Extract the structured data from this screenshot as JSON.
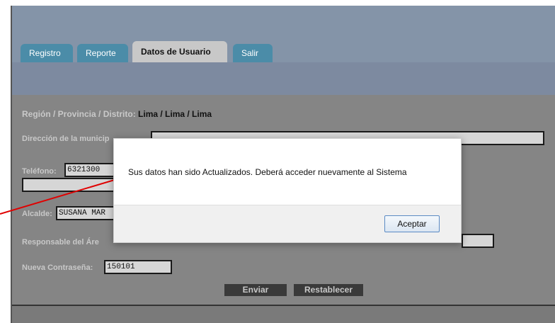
{
  "tabs": [
    {
      "label": "Registro",
      "active": false
    },
    {
      "label": "Reporte",
      "active": false
    },
    {
      "label": "Datos de Usuario",
      "active": true
    },
    {
      "label": "Salir",
      "active": false
    }
  ],
  "region": {
    "label": "Región / Provincia / Distrito:",
    "value": "Lima / Lima / Lima"
  },
  "form": {
    "direccion_label": "Dirección de la municip",
    "telefono_label": "Teléfono:",
    "telefono_value": "6321300",
    "alcalde_label": "Alcalde:",
    "alcalde_value": "SUSANA MAR",
    "responsable_label": "Responsable del Áre",
    "password_label": "Nueva Contraseña:",
    "password_value": "150101",
    "submit_label": "Enviar",
    "reset_label": "Restablecer"
  },
  "dialog": {
    "message": "Sus datos han sido Actualizados. Deberá acceder nuevamente al Sistema",
    "ok_label": "Aceptar"
  },
  "colors": {
    "pointer_line": "#e00000",
    "tab_inactive": "#4b8ca8",
    "dialog_button_border": "#5b8bc4"
  }
}
